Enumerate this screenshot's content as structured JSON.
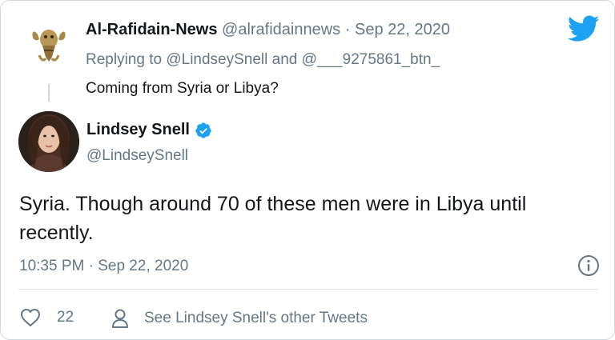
{
  "reply_tweet": {
    "display_name": "Al-Rafidain-News",
    "handle": "@alrafidainnews",
    "date": "Sep 22, 2020",
    "replying_prefix": "Replying to",
    "replying_to_1": "@LindseySnell",
    "replying_and": "and",
    "replying_to_2": "@___9275861_btn_",
    "text": "Coming from Syria or Libya?"
  },
  "main_tweet": {
    "display_name": "Lindsey Snell",
    "handle": "@LindseySnell",
    "text": "Syria. Though around 70 of these men were in Libya until recently.",
    "time": "10:35 PM",
    "date": "Sep 22, 2020",
    "likes": "22",
    "other_tweets_label": "See Lindsey Snell's other Tweets"
  },
  "icons": {
    "brand": "twitter-bird-icon",
    "verified": "verified-badge-icon",
    "info": "info-icon",
    "like": "heart-icon",
    "profile": "person-icon"
  },
  "colors": {
    "twitter_blue": "#1da1f2",
    "secondary_text": "#657786",
    "primary_text": "#14171a"
  }
}
